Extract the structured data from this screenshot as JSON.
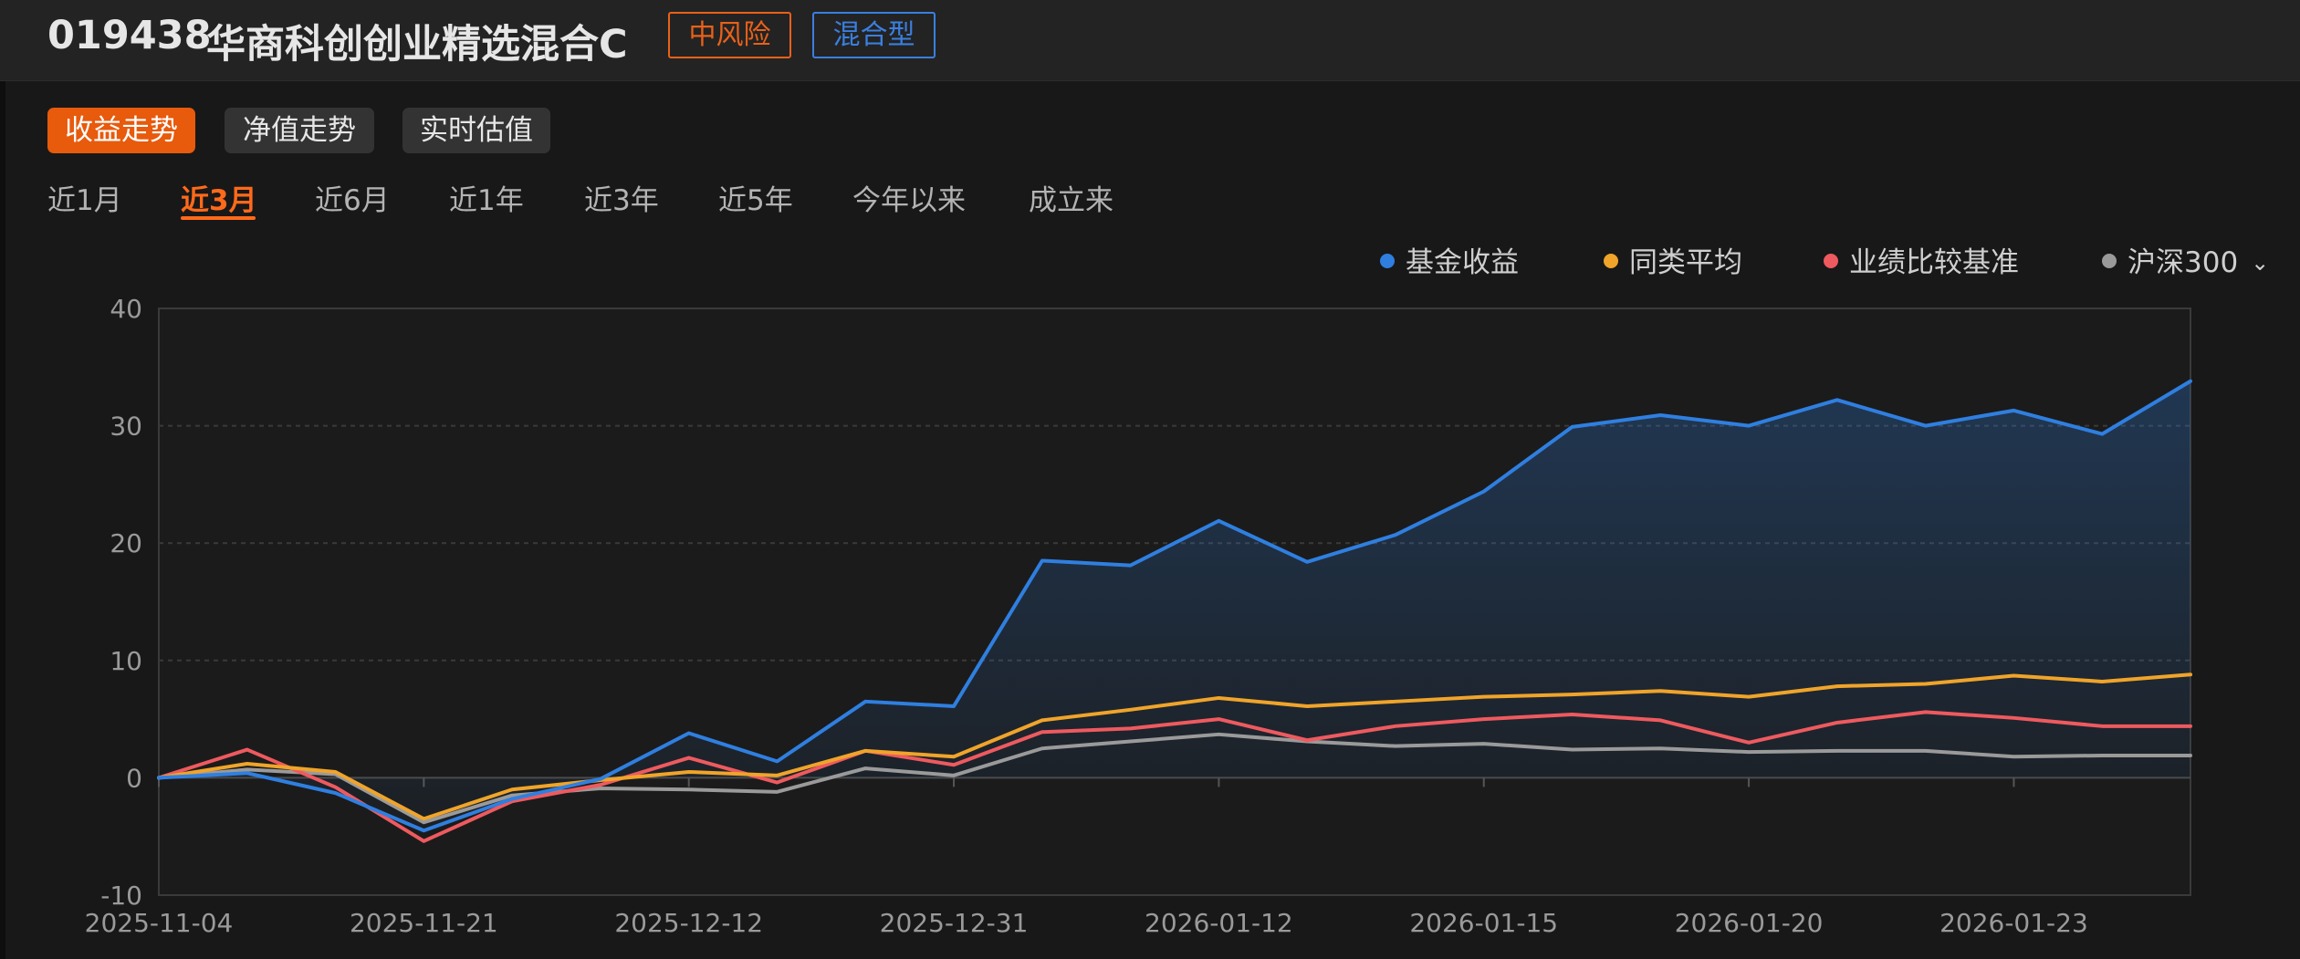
{
  "header": {
    "fund_code": "019438",
    "fund_name": "华商科创创业精选混合C",
    "tags": [
      {
        "label": "中风险",
        "color": "#e8611a"
      },
      {
        "label": "混合型",
        "color": "#3a7fe0"
      }
    ]
  },
  "view_tabs": {
    "items": [
      "收益走势",
      "净值走势",
      "实时估值"
    ],
    "active": 0
  },
  "range_tabs": {
    "items": [
      "近1月",
      "近3月",
      "近6月",
      "近1年",
      "近3年",
      "近5年",
      "今年以来",
      "成立来"
    ],
    "active": 1
  },
  "legend": {
    "chevron": "chevron-down-icon"
  },
  "colors": {
    "accent": "#e85a0c",
    "fund": "#2f7fe0",
    "category_avg": "#f0a42a",
    "benchmark": "#ee5a5f",
    "csi300": "#9a9a9a"
  },
  "chart_data": {
    "type": "line",
    "x": [
      "2025-11-04",
      "",
      "",
      "2025-11-21",
      "",
      "",
      "2025-12-12",
      "",
      "",
      "2025-12-31",
      "",
      "",
      "2026-01-12",
      "",
      "",
      "2026-01-15",
      "",
      "",
      "2026-01-20",
      "",
      "",
      "2026-01-23",
      "",
      "",
      ""
    ],
    "x_tick_labels": [
      "2025-11-04",
      "2025-11-21",
      "2025-12-12",
      "2025-12-31",
      "2026-01-12",
      "2026-01-15",
      "2026-01-20",
      "2026-01-23"
    ],
    "ylim": [
      -10,
      40
    ],
    "yticks": [
      -10,
      0,
      10,
      20,
      30,
      40
    ],
    "grid": true,
    "legend_position": "top-right",
    "series": [
      {
        "name": "基金收益",
        "color": "#2f7fe0",
        "area": true,
        "values": [
          0,
          0.4,
          -1.3,
          -4.5,
          -1.8,
          -0.1,
          3.8,
          1.4,
          6.5,
          6.1,
          18.5,
          18.1,
          21.9,
          18.4,
          20.7,
          24.4,
          29.9,
          30.9,
          30.0,
          32.2,
          30.0,
          31.3,
          29.3,
          33.8
        ]
      },
      {
        "name": "同类平均",
        "color": "#f0a42a",
        "values": [
          0,
          1.2,
          0.5,
          -3.5,
          -1.0,
          -0.2,
          0.5,
          0.2,
          2.3,
          1.8,
          4.9,
          5.8,
          6.8,
          6.1,
          6.5,
          6.9,
          7.1,
          7.4,
          6.9,
          7.8,
          8.0,
          8.7,
          8.2,
          8.8
        ]
      },
      {
        "name": "业绩比较基准",
        "color": "#ee5a5f",
        "values": [
          0,
          2.4,
          -0.8,
          -5.4,
          -2.0,
          -0.6,
          1.7,
          -0.4,
          2.3,
          1.1,
          3.9,
          4.2,
          5.0,
          3.2,
          4.4,
          5.0,
          5.4,
          4.9,
          3.0,
          4.7,
          5.6,
          5.1,
          4.4,
          4.4
        ]
      },
      {
        "name": "沪深300",
        "color": "#9a9a9a",
        "values": [
          0,
          0.7,
          0.3,
          -3.8,
          -1.5,
          -0.9,
          -1.0,
          -1.2,
          0.8,
          0.2,
          2.5,
          3.1,
          3.7,
          3.1,
          2.7,
          2.9,
          2.4,
          2.5,
          2.2,
          2.3,
          2.3,
          1.8,
          1.9,
          1.9
        ]
      }
    ]
  }
}
